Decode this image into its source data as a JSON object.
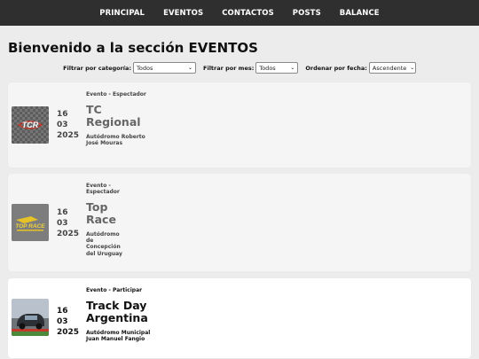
{
  "nav": {
    "items": [
      "PRINCIPAL",
      "EVENTOS",
      "CONTACTOS",
      "POSTS",
      "BALANCE"
    ]
  },
  "page": {
    "title": "Bienvenido a la sección EVENTOS"
  },
  "filters": {
    "category_label": "Filtrar por categoría:",
    "category_value": "Todos",
    "month_label": "Filtrar por mes:",
    "month_value": "Todos",
    "order_label": "Ordenar por fecha:",
    "order_value": "Ascendente"
  },
  "events": [
    {
      "type": "Evento - Espectador",
      "day": "16",
      "month": "03",
      "year": "2025",
      "name": "TC Regional",
      "venue": "Autódromo Roberto José Mouras",
      "logo": "TCR"
    },
    {
      "type": "Evento - Espectador",
      "day": "16",
      "month": "03",
      "year": "2025",
      "name": "Top Race",
      "venue": "Autódromo de Concepción del Uruguay",
      "logo": "TOP RACE"
    },
    {
      "type": "Evento - Participar",
      "day": "16",
      "month": "03",
      "year": "2025",
      "name": "Track Day Argentina",
      "venue": "Autódromo Municipal Juan Manuel Fangio",
      "logo": ""
    }
  ],
  "colors": {
    "navbar": "#2f2f2f",
    "page_bg": "#ececec",
    "card_bg": "#f5f5f5",
    "card_active_bg": "#ffffff"
  }
}
